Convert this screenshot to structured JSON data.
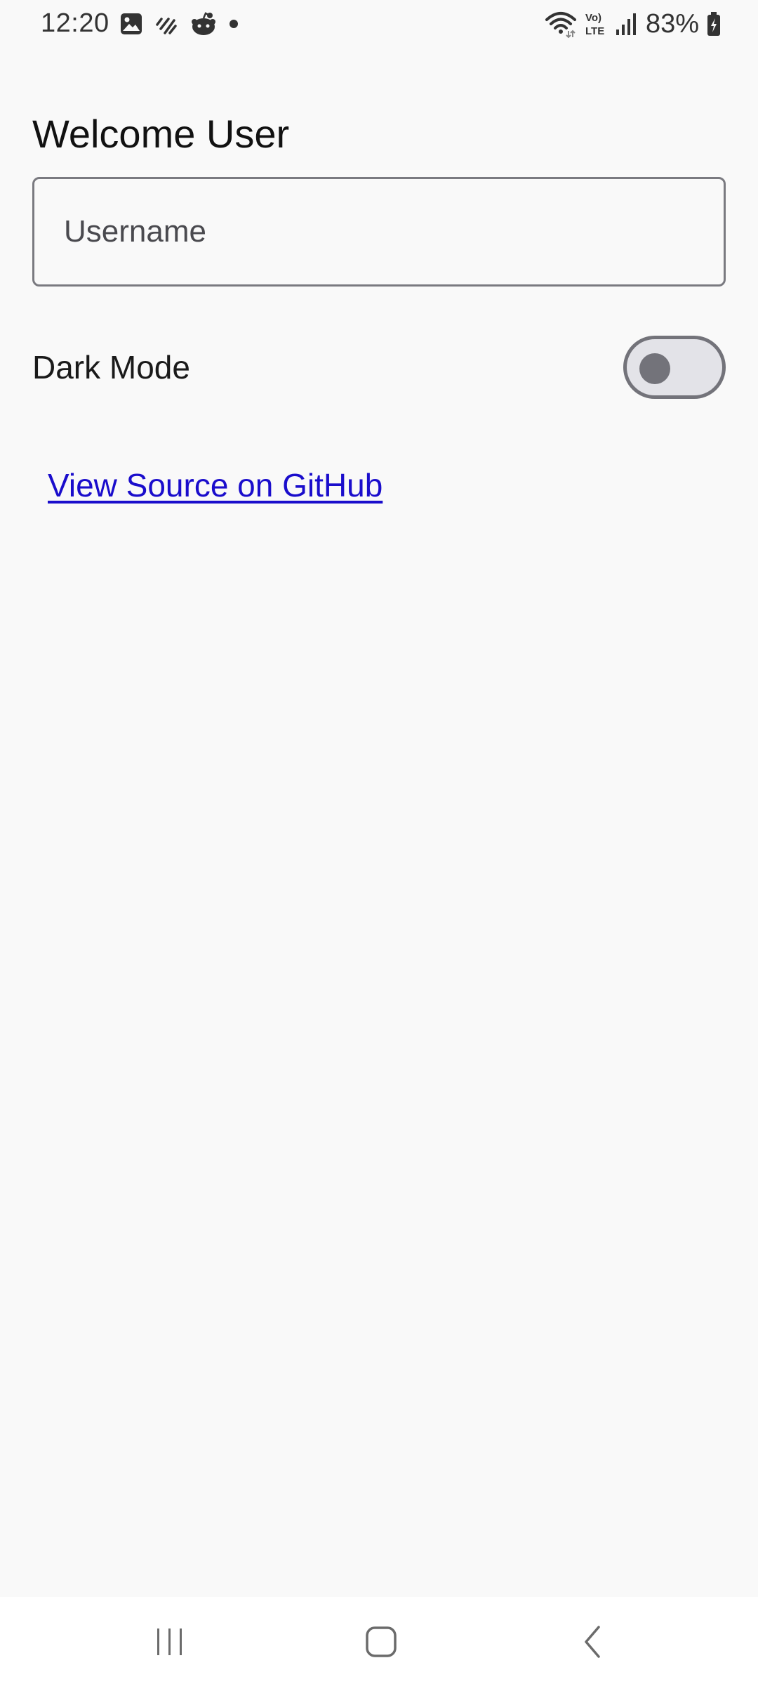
{
  "status_bar": {
    "time": "12:20",
    "battery_percent": "83%",
    "left_icons": [
      "gallery-icon",
      "signal-stripes-icon",
      "reddit-icon",
      "notification-dot-icon"
    ],
    "right_icons": [
      "wifi-icon",
      "volte-icon",
      "cell-signal-icon",
      "battery-charging-icon"
    ]
  },
  "main": {
    "title": "Welcome User",
    "username_field": {
      "placeholder": "Username",
      "value": ""
    },
    "dark_mode": {
      "label": "Dark Mode",
      "enabled": false
    },
    "github_link": "View Source on GitHub"
  },
  "nav_bar": {
    "buttons": [
      "recents-icon",
      "home-icon",
      "back-icon"
    ]
  },
  "colors": {
    "background": "#f9f9f9",
    "link": "#1a0dcc",
    "switch_track_off": "#e3e3e8",
    "switch_outline": "#73737a",
    "field_border": "#7a7a80",
    "nav_background": "#ffffff"
  }
}
